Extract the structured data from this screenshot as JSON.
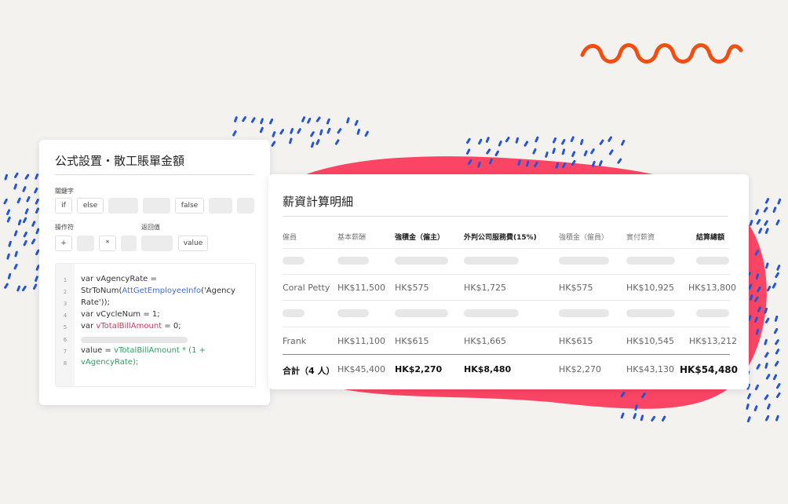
{
  "formula_panel": {
    "title": "公式設置・散工賬單金額",
    "keywords_label": "關鍵字",
    "keywords": [
      "if",
      "else",
      "false"
    ],
    "operators_label": "操作符",
    "operators": [
      "+",
      "*"
    ],
    "return_label": "返回值",
    "return_value": "value",
    "line_numbers": [
      "1",
      "2",
      "3",
      "4",
      "5",
      "6",
      "7",
      "8"
    ],
    "code": {
      "l1": "var vAgencyRate =",
      "l2a": "StrToNum(",
      "l2b": "AttGetEmployeeInfo",
      "l2c": "('Agency",
      "l3": "Rate'));",
      "l4": "var vCycleNum = 1;",
      "l5a": "var ",
      "l5b": "vTotalBillAmount",
      "l5c": " = 0;",
      "l7a": "value = ",
      "l7b": "vTotalBillAmount * (1 +",
      "l8": "vAgencyRate);"
    }
  },
  "payroll_panel": {
    "title": "薪資計算明細",
    "headers": [
      "僱員",
      "基本薪酬",
      "強積金（僱主）",
      "外判公司服務費(15%)",
      "強積金（僱員）",
      "實付薪資",
      "結算總額"
    ],
    "rows": [
      [
        "Coral Petty",
        "HK$11,500",
        "HK$575",
        "HK$1,725",
        "HK$575",
        "HK$10,925",
        "HK$13,800"
      ],
      [
        "Frank",
        "HK$11,100",
        "HK$615",
        "HK$1,665",
        "HK$615",
        "HK$10,545",
        "HK$13,212"
      ]
    ],
    "total_row": [
      "合計（4 人）",
      "HK$45,400",
      "HK$2,270",
      "HK$8,480",
      "HK$2,270",
      "HK$43,130",
      "HK$54,480"
    ]
  },
  "colors": {
    "background": "#f4f2ef",
    "blob": "#fb4565",
    "squiggle": "#f04f14",
    "dots": "#2455d6",
    "function": "#3d6fd6",
    "variable": "#d2365a",
    "expression": "#2f9e62"
  }
}
